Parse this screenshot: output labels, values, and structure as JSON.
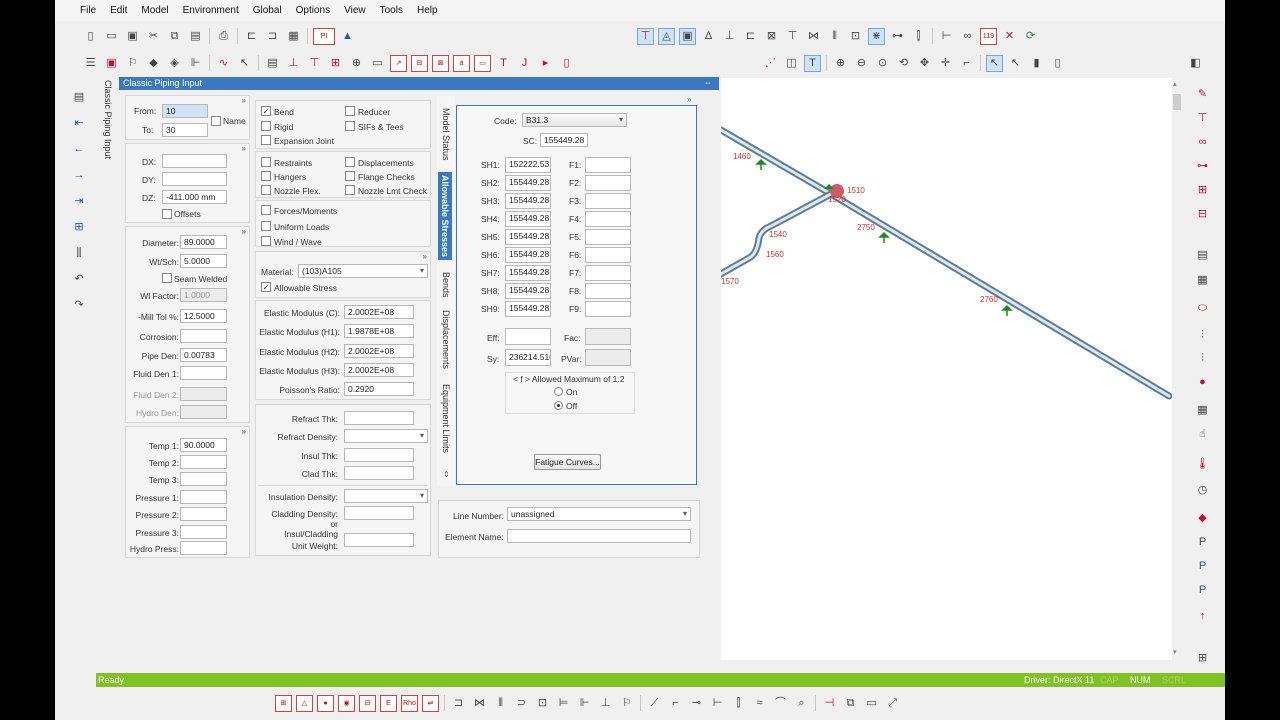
{
  "menu": [
    "File",
    "Edit",
    "Model",
    "Environment",
    "Global",
    "Options",
    "View",
    "Tools",
    "Help"
  ],
  "panel_title": "Classic Piping Input",
  "sidebar_tab": "Classic Piping Input",
  "nodes": {
    "from_label": "From:",
    "from": "10",
    "to_label": "To:",
    "to": "30",
    "name_label": "Name"
  },
  "deltas": {
    "dx_label": "DX:",
    "dx": "",
    "dy_label": "DY:",
    "dy": "",
    "dz_label": "DZ:",
    "dz": "-411.000 mm",
    "offsets_label": "Offsets"
  },
  "pipe": {
    "diameter_label": "Diameter:",
    "diameter": "89.0000",
    "wt_label": "Wt/Sch:",
    "wt": "5.0000",
    "seam_label": "Seam Welded",
    "wf_label": "Wl Factor:",
    "wf": "1.0000",
    "mill_label": "-Mill Tol %:",
    "mill": "12.5000",
    "corr_label": "Corrosion:",
    "corr": "",
    "pden_label": "Pipe Den:",
    "pden": "0.00783",
    "fd1_label": "Fluid Den 1:",
    "fd1": "",
    "fd2_label": "Fluid Den 2:",
    "fd2": "",
    "hd_label": "Hydro Den:",
    "hd": ""
  },
  "temps": {
    "t1_label": "Temp 1:",
    "t1": "90.0000",
    "t2_label": "Temp 2:",
    "t3_label": "Temp 3:",
    "p1_label": "Pressure 1:",
    "p2_label": "Pressure 2:",
    "p3_label": "Pressure 3:",
    "hp_label": "Hydro Press:"
  },
  "checks": {
    "bend": "Bend",
    "reducer": "Reducer",
    "rigid": "Rigid",
    "sifs": "SIFs & Tees",
    "expjoint": "Expansion Joint",
    "restraints": "Restraints",
    "displacements": "Displacements",
    "hangers": "Hangers",
    "flange": "Flange Checks",
    "nozzleflex": "Nozzle Flex.",
    "nozzlelmt": "Nozzle Lmt Check",
    "forces": "Forces/Moments",
    "uniform": "Uniform Loads",
    "wind": "Wind / Wave"
  },
  "material": {
    "label": "Material:",
    "value": "(103)A105",
    "allow_label": "Allowable Stress",
    "em_c_label": "Elastic Modulus (C):",
    "em_c": "2.0002E+08",
    "em_h1_label": "Elastic Modulus (H1):",
    "em_h1": "1.9878E+08",
    "em_h2_label": "Elastic Modulus (H2):",
    "em_h2": "2.0002E+08",
    "em_h3_label": "Elastic Modulus (H3):",
    "em_h3": "2.0002E+08",
    "pr_label": "Poisson's Ratio:",
    "pr": "0.2920"
  },
  "insul": {
    "rthk": "Refract Thk:",
    "rden": "Refract Density:",
    "ithk": "Insul Thk:",
    "cthk": "Clad Thk:",
    "iden": "Insulation Density:",
    "cden": "Cladding Density:",
    "or": "or",
    "uw1": "Insul/Cladding",
    "uw2": "Unit Weight:"
  },
  "tabs": [
    "Model Status",
    "Allowable Stresses",
    "Bends",
    "Displacements",
    "Equipment Limits"
  ],
  "allow": {
    "code_label": "Code:",
    "code": "B31.3",
    "sc_label": "SC:",
    "sc": "155449.28",
    "sh": [
      {
        "l": "SH1:",
        "v": "152222.53"
      },
      {
        "l": "SH2:",
        "v": "155449.28"
      },
      {
        "l": "SH3:",
        "v": "155449.28"
      },
      {
        "l": "SH4:",
        "v": "155449.28"
      },
      {
        "l": "SH5:",
        "v": "155449.28"
      },
      {
        "l": "SH6:",
        "v": "155449.28"
      },
      {
        "l": "SH7:",
        "v": "155449.28"
      },
      {
        "l": "SH8:",
        "v": "155449.28"
      },
      {
        "l": "SH9:",
        "v": "155449.28"
      }
    ],
    "f": [
      "F1:",
      "F2:",
      "F3:",
      "F4:",
      "F5:",
      "F6:",
      "F7:",
      "F8:",
      "F9:"
    ],
    "eff_label": "Eff:",
    "fac_label": "Fac:",
    "sy_label": "Sy:",
    "sy": "236214.516",
    "pvar_label": "PVar:",
    "fmax": "< f > Allowed Maximum of 1.2",
    "on": "On",
    "off": "Off",
    "fatigue": "Fatigue Curves..."
  },
  "line": {
    "num_label": "Line Number:",
    "num": "unassigned",
    "el_label": "Element Name:",
    "el": ""
  },
  "status": {
    "ready": "Ready",
    "driver": "Driver: DirectX 11",
    "cap": "CAP",
    "num": "NUM",
    "scrl": "SCRL"
  },
  "node_labels": [
    "1460",
    "1510",
    "1520",
    "2750",
    "1540",
    "1560",
    "2760",
    "1570"
  ]
}
